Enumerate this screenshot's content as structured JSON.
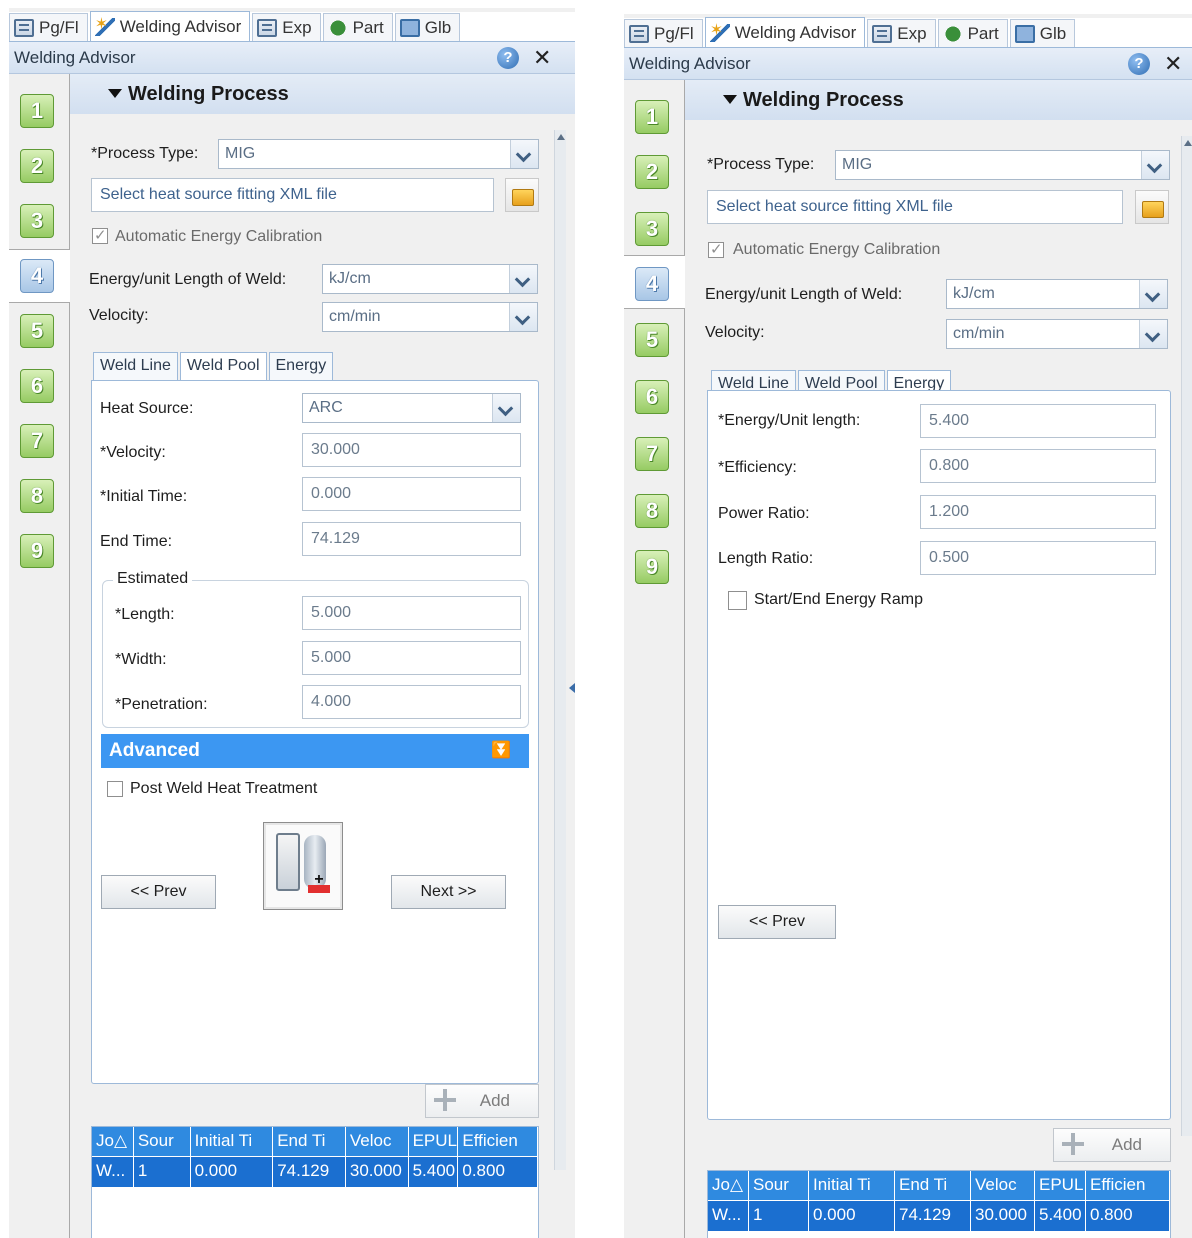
{
  "left_panel": {
    "tabs": [
      {
        "label": "Pg/Fl",
        "icon": "tree-icon"
      },
      {
        "label": "Welding Advisor",
        "icon": "wand-icon"
      },
      {
        "label": "Exp",
        "icon": "tree-icon"
      },
      {
        "label": "Part",
        "icon": "puzzle-icon"
      },
      {
        "label": "Glb",
        "icon": "global-icon"
      }
    ],
    "header_title": "Welding Advisor",
    "header_help": "?",
    "header_close": "✕",
    "steps": [
      "1",
      "2",
      "3",
      "4",
      "5",
      "6",
      "7",
      "8",
      "9"
    ],
    "selected_step": "4",
    "section_title": "Welding Process",
    "process_type_label": "*Process Type:",
    "process_type_value": "MIG",
    "heat_source_placeholder": "Select heat source fitting XML file",
    "auto_calibration_label": "Automatic Energy Calibration",
    "energy_label": "Energy/unit Length of Weld:",
    "energy_unit": "kJ/cm",
    "velocity_label": "Velocity:",
    "velocity_unit": "cm/min",
    "inner_tabs": [
      "Weld Line",
      "Weld Pool",
      "Energy"
    ],
    "active_inner_tab": "Weld Pool",
    "weld_pool": {
      "heat_source_label": "Heat Source:",
      "heat_source_value": "ARC",
      "velocity_label": "*Velocity:",
      "velocity_value": "30.000",
      "initial_time_label": "*Initial Time:",
      "initial_time_value": "0.000",
      "end_time_label": "End Time:",
      "end_time_value": "74.129",
      "estimated_label": "Estimated",
      "length_label": "*Length:",
      "length_value": "5.000",
      "width_label": "*Width:",
      "width_value": "5.000",
      "penetration_label": "*Penetration:",
      "penetration_value": "4.000"
    },
    "advanced_label": "Advanced",
    "advanced_chevron": "⏬",
    "post_weld_label": "Post Weld Heat Treatment",
    "prev_label": "<< Prev",
    "next_label": "Next >>",
    "add_label": "Add"
  },
  "right_panel": {
    "tabs": [
      {
        "label": "Pg/Fl",
        "icon": "tree-icon"
      },
      {
        "label": "Welding Advisor",
        "icon": "wand-icon"
      },
      {
        "label": "Exp",
        "icon": "tree-icon"
      },
      {
        "label": "Part",
        "icon": "puzzle-icon"
      },
      {
        "label": "Glb",
        "icon": "global-icon"
      }
    ],
    "header_title": "Welding Advisor",
    "header_help": "?",
    "header_close": "✕",
    "steps": [
      "1",
      "2",
      "3",
      "4",
      "5",
      "6",
      "7",
      "8",
      "9"
    ],
    "selected_step": "4",
    "section_title": "Welding Process",
    "process_type_label": "*Process Type:",
    "process_type_value": "MIG",
    "heat_source_placeholder": "Select heat source fitting XML file",
    "auto_calibration_label": "Automatic Energy Calibration",
    "energy_label": "Energy/unit Length of Weld:",
    "energy_unit": "kJ/cm",
    "velocity_label": "Velocity:",
    "velocity_unit": "cm/min",
    "inner_tabs": [
      "Weld Line",
      "Weld Pool",
      "Energy"
    ],
    "active_inner_tab": "Energy",
    "energy": {
      "energy_per_length_label": "*Energy/Unit length:",
      "energy_per_length_value": "5.400",
      "efficiency_label": "*Efficiency:",
      "efficiency_value": "0.800",
      "power_ratio_label": "Power Ratio:",
      "power_ratio_value": "1.200",
      "length_ratio_label": "Length Ratio:",
      "length_ratio_value": "0.500",
      "ramp_label": "Start/End Energy Ramp"
    },
    "prev_label": "<< Prev",
    "add_label": "Add"
  },
  "grid": {
    "columns": [
      "Jo△",
      "Sour",
      "Initial Ti",
      "End Ti",
      "Veloc",
      "EPUL",
      "Efficien"
    ],
    "row": [
      "W...",
      "1",
      "0.000",
      "74.129",
      "30.000",
      "5.400",
      "0.800"
    ]
  },
  "colors": {
    "selection_blue": "#1b6fd0",
    "header_blue": "#2f8ae0",
    "advanced_bar": "#3c97f2",
    "step_green": "#96cb63"
  }
}
